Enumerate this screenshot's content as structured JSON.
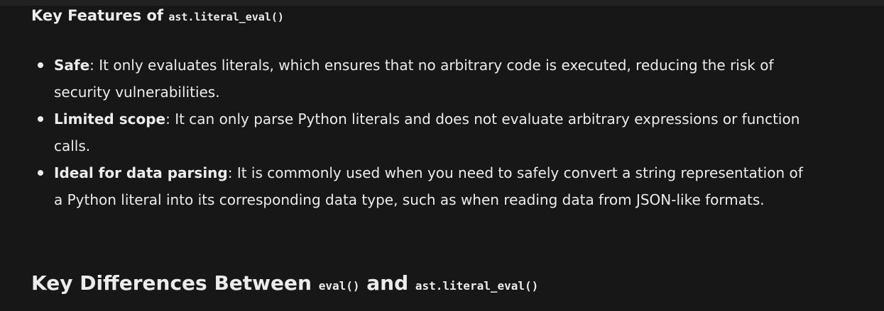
{
  "features_heading": {
    "text": "Key Features of",
    "code": "ast.literal_eval()"
  },
  "features": [
    {
      "term": "Safe",
      "description": ": It only evaluates literals, which ensures that no arbitrary code is executed, reducing the risk of security vulnerabilities."
    },
    {
      "term": "Limited scope",
      "description": ": It can only parse Python literals and does not evaluate arbitrary expressions or function calls."
    },
    {
      "term": "Ideal for data parsing",
      "description": ": It is commonly used when you need to safely convert a string representation of a Python literal into its corresponding data type, such as when reading data from JSON-like formats."
    }
  ],
  "differences_heading": {
    "text_before": "Key Differences Between",
    "code_1": "eval()",
    "text_middle": "and",
    "code_2": "ast.literal_eval()"
  }
}
